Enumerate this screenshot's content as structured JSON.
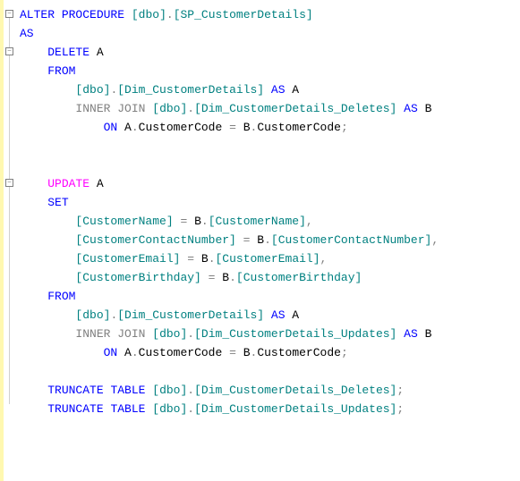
{
  "code": {
    "lines": [
      {
        "indent": 0,
        "tokens": [
          [
            "kw-blue",
            "ALTER"
          ],
          [
            "text",
            " "
          ],
          [
            "kw-blue",
            "PROCEDURE"
          ],
          [
            "text",
            " "
          ],
          [
            "kw-teal",
            "[dbo]"
          ],
          [
            "punct",
            "."
          ],
          [
            "kw-teal",
            "[SP_CustomerDetails]"
          ]
        ]
      },
      {
        "indent": 0,
        "tokens": [
          [
            "kw-blue",
            "AS"
          ]
        ]
      },
      {
        "indent": 1,
        "tokens": [
          [
            "kw-blue",
            "DELETE"
          ],
          [
            "text",
            " A"
          ]
        ]
      },
      {
        "indent": 1,
        "tokens": [
          [
            "kw-blue",
            "FROM"
          ]
        ]
      },
      {
        "indent": 2,
        "tokens": [
          [
            "kw-teal",
            "[dbo]"
          ],
          [
            "punct",
            "."
          ],
          [
            "kw-teal",
            "[Dim_CustomerDetails]"
          ],
          [
            "text",
            " "
          ],
          [
            "kw-blue",
            "AS"
          ],
          [
            "text",
            " A"
          ]
        ]
      },
      {
        "indent": 2,
        "tokens": [
          [
            "kw-gray",
            "INNER"
          ],
          [
            "text",
            " "
          ],
          [
            "kw-gray",
            "JOIN"
          ],
          [
            "text",
            " "
          ],
          [
            "kw-teal",
            "[dbo]"
          ],
          [
            "punct",
            "."
          ],
          [
            "kw-teal",
            "[Dim_CustomerDetails_Deletes]"
          ],
          [
            "text",
            " "
          ],
          [
            "kw-blue",
            "AS"
          ],
          [
            "text",
            " B"
          ]
        ]
      },
      {
        "indent": 3,
        "tokens": [
          [
            "kw-blue",
            "ON"
          ],
          [
            "text",
            " A"
          ],
          [
            "punct",
            "."
          ],
          [
            "text",
            "CustomerCode "
          ],
          [
            "punct",
            "="
          ],
          [
            "text",
            " B"
          ],
          [
            "punct",
            "."
          ],
          [
            "text",
            "CustomerCode"
          ],
          [
            "punct",
            ";"
          ]
        ]
      },
      {
        "indent": 0,
        "tokens": []
      },
      {
        "indent": 0,
        "tokens": []
      },
      {
        "indent": 1,
        "tokens": [
          [
            "kw-magenta",
            "UPDATE"
          ],
          [
            "text",
            " A"
          ]
        ]
      },
      {
        "indent": 1,
        "tokens": [
          [
            "kw-blue",
            "SET"
          ]
        ]
      },
      {
        "indent": 2,
        "tokens": [
          [
            "kw-teal",
            "[CustomerName]"
          ],
          [
            "text",
            " "
          ],
          [
            "punct",
            "="
          ],
          [
            "text",
            " B"
          ],
          [
            "punct",
            "."
          ],
          [
            "kw-teal",
            "[CustomerName]"
          ],
          [
            "punct",
            ","
          ]
        ]
      },
      {
        "indent": 2,
        "tokens": [
          [
            "kw-teal",
            "[CustomerContactNumber]"
          ],
          [
            "text",
            " "
          ],
          [
            "punct",
            "="
          ],
          [
            "text",
            " B"
          ],
          [
            "punct",
            "."
          ],
          [
            "kw-teal",
            "[CustomerContactNumber]"
          ],
          [
            "punct",
            ","
          ]
        ]
      },
      {
        "indent": 2,
        "tokens": [
          [
            "kw-teal",
            "[CustomerEmail]"
          ],
          [
            "text",
            " "
          ],
          [
            "punct",
            "="
          ],
          [
            "text",
            " B"
          ],
          [
            "punct",
            "."
          ],
          [
            "kw-teal",
            "[CustomerEmail]"
          ],
          [
            "punct",
            ","
          ]
        ]
      },
      {
        "indent": 2,
        "tokens": [
          [
            "kw-teal",
            "[CustomerBirthday]"
          ],
          [
            "text",
            " "
          ],
          [
            "punct",
            "="
          ],
          [
            "text",
            " B"
          ],
          [
            "punct",
            "."
          ],
          [
            "kw-teal",
            "[CustomerBirthday]"
          ]
        ]
      },
      {
        "indent": 1,
        "tokens": [
          [
            "kw-blue",
            "FROM"
          ]
        ]
      },
      {
        "indent": 2,
        "tokens": [
          [
            "kw-teal",
            "[dbo]"
          ],
          [
            "punct",
            "."
          ],
          [
            "kw-teal",
            "[Dim_CustomerDetails]"
          ],
          [
            "text",
            " "
          ],
          [
            "kw-blue",
            "AS"
          ],
          [
            "text",
            " A"
          ]
        ]
      },
      {
        "indent": 2,
        "tokens": [
          [
            "kw-gray",
            "INNER"
          ],
          [
            "text",
            " "
          ],
          [
            "kw-gray",
            "JOIN"
          ],
          [
            "text",
            " "
          ],
          [
            "kw-teal",
            "[dbo]"
          ],
          [
            "punct",
            "."
          ],
          [
            "kw-teal",
            "[Dim_CustomerDetails_Updates]"
          ],
          [
            "text",
            " "
          ],
          [
            "kw-blue",
            "AS"
          ],
          [
            "text",
            " B"
          ]
        ]
      },
      {
        "indent": 3,
        "tokens": [
          [
            "kw-blue",
            "ON"
          ],
          [
            "text",
            " A"
          ],
          [
            "punct",
            "."
          ],
          [
            "text",
            "CustomerCode "
          ],
          [
            "punct",
            "="
          ],
          [
            "text",
            " B"
          ],
          [
            "punct",
            "."
          ],
          [
            "text",
            "CustomerCode"
          ],
          [
            "punct",
            ";"
          ]
        ]
      },
      {
        "indent": 0,
        "tokens": []
      },
      {
        "indent": 1,
        "tokens": [
          [
            "kw-blue",
            "TRUNCATE"
          ],
          [
            "text",
            " "
          ],
          [
            "kw-blue",
            "TABLE"
          ],
          [
            "text",
            " "
          ],
          [
            "kw-teal",
            "[dbo]"
          ],
          [
            "punct",
            "."
          ],
          [
            "kw-teal",
            "[Dim_CustomerDetails_Deletes]"
          ],
          [
            "punct",
            ";"
          ]
        ]
      },
      {
        "indent": 1,
        "tokens": [
          [
            "kw-blue",
            "TRUNCATE"
          ],
          [
            "text",
            " "
          ],
          [
            "kw-blue",
            "TABLE"
          ],
          [
            "text",
            " "
          ],
          [
            "kw-teal",
            "[dbo]"
          ],
          [
            "punct",
            "."
          ],
          [
            "kw-teal",
            "[Dim_CustomerDetails_Updates]"
          ],
          [
            "punct",
            ";"
          ]
        ]
      }
    ],
    "folds": [
      {
        "line": 0
      },
      {
        "line": 2
      },
      {
        "line": 9
      }
    ]
  }
}
